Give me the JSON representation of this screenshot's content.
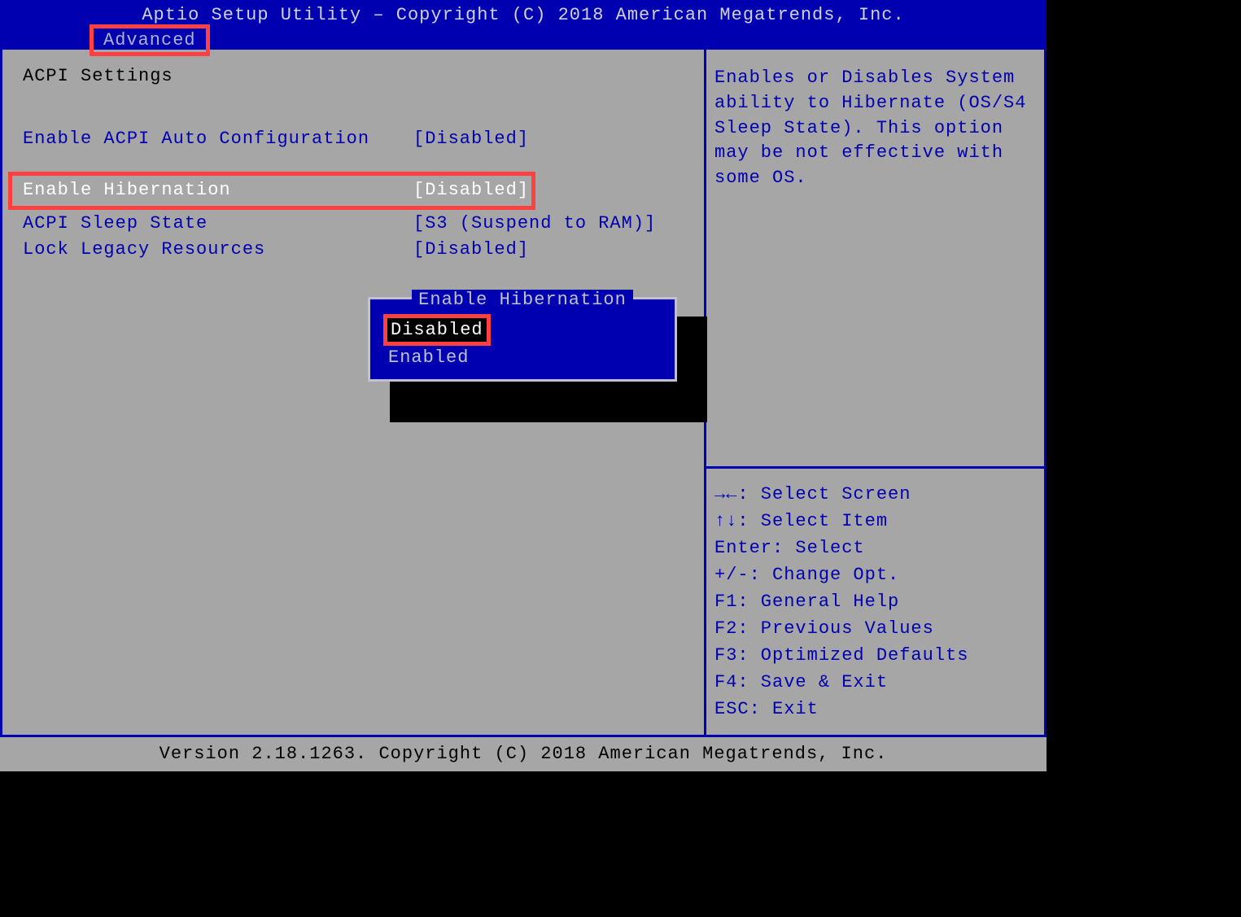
{
  "header": {
    "title": "Aptio Setup Utility – Copyright (C) 2018 American Megatrends, Inc.",
    "tab": "Advanced"
  },
  "section": {
    "title": "ACPI Settings"
  },
  "settings": [
    {
      "label": "Enable ACPI Auto Configuration",
      "value": "[Disabled]",
      "selected": false
    },
    {
      "label": "Enable Hibernation",
      "value": "[Disabled]",
      "selected": true
    },
    {
      "label": "ACPI Sleep State",
      "value": "[S3 (Suspend to RAM)]",
      "selected": false
    },
    {
      "label": "Lock Legacy Resources",
      "value": "[Disabled]",
      "selected": false
    }
  ],
  "popup": {
    "title": "Enable Hibernation",
    "options": [
      {
        "label": "Disabled",
        "selected": true
      },
      {
        "label": "Enabled",
        "selected": false
      }
    ]
  },
  "help_text": "Enables or Disables System ability to Hibernate (OS/S4 Sleep State). This option may be not effective with some OS.",
  "key_help": [
    "→←: Select Screen",
    "↑↓: Select Item",
    "Enter: Select",
    "+/-: Change Opt.",
    "F1: General Help",
    "F2: Previous Values",
    "F3: Optimized Defaults",
    "F4: Save & Exit",
    "ESC: Exit"
  ],
  "footer": "Version 2.18.1263. Copyright (C) 2018 American Megatrends, Inc."
}
